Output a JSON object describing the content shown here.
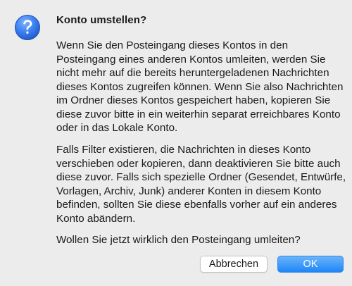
{
  "dialog": {
    "title": "Konto umstellen?",
    "icon": "question-icon",
    "paragraphs": [
      "Wenn Sie den Posteingang dieses Kontos in den Posteingang eines anderen Kontos umleiten, werden Sie nicht mehr auf die bereits heruntergeladenen Nachrichten dieses Kontos zugreifen können. Wenn Sie also Nachrichten im Ordner dieses Kontos gespeichert haben, kopieren Sie diese zuvor bitte in ein weiterhin separat erreichbares Konto oder in das Lokale Konto.",
      "Falls Filter existieren, die Nachrichten in dieses Konto verschieben oder kopieren, dann deaktivieren Sie bitte auch diese zuvor. Falls sich spezielle Ordner (Gesendet, Entwürfe, Vorlagen, Archiv, Junk) anderer Konten in diesem Konto befinden, sollten Sie diese ebenfalls vorher auf ein anderes Konto abändern.",
      "Wollen Sie jetzt wirklich den Posteingang umleiten?"
    ],
    "buttons": {
      "cancel_label": "Abbrechen",
      "ok_label": "OK"
    }
  },
  "colors": {
    "background": "#ececec",
    "icon_blue": "#2e6fe0",
    "ok_button": "#1d86f7"
  }
}
